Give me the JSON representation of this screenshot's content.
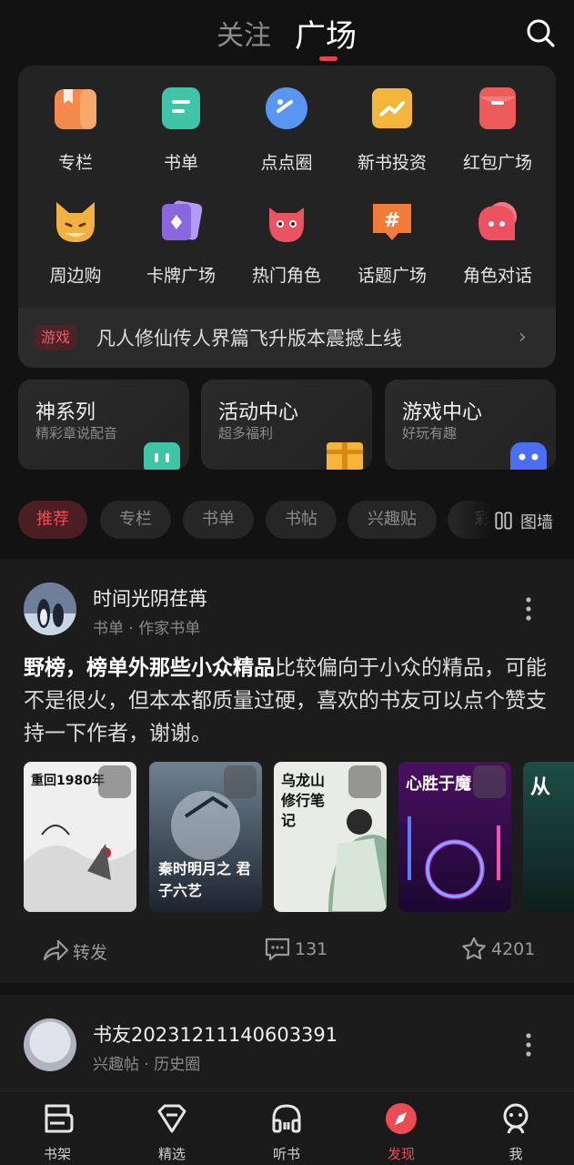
{
  "header": {
    "tabs": [
      {
        "label": "关注",
        "active": false
      },
      {
        "label": "广场",
        "active": true
      }
    ],
    "search_icon": "search-icon"
  },
  "grid": {
    "items": [
      {
        "label": "专栏",
        "icon": "column-icon",
        "color": "#f38a4b"
      },
      {
        "label": "书单",
        "icon": "booklist-icon",
        "color": "#3fc4a8"
      },
      {
        "label": "点点圈",
        "icon": "planet-icon",
        "color": "#4a8cf0"
      },
      {
        "label": "新书投资",
        "icon": "invest-icon",
        "color": "#f5b53a"
      },
      {
        "label": "红包广场",
        "icon": "redpacket-icon",
        "color": "#ec5a5a"
      },
      {
        "label": "周边购",
        "icon": "fox-icon",
        "color": "#f3b144"
      },
      {
        "label": "卡牌广场",
        "icon": "cards-icon",
        "color": "#8a66e0"
      },
      {
        "label": "热门角色",
        "icon": "monster-icon",
        "color": "#ea5461"
      },
      {
        "label": "话题广场",
        "icon": "hashtag-icon",
        "color": "#f27b3a"
      },
      {
        "label": "角色对话",
        "icon": "chat-bubble-icon",
        "color": "#ee5260"
      }
    ],
    "promo": {
      "tag": "游戏",
      "text": "凡人修仙传人界篇飞升版本震撼上线"
    }
  },
  "cards": [
    {
      "title": "神系列",
      "subtitle": "精彩章说配音"
    },
    {
      "title": "活动中心",
      "subtitle": "超多福利"
    },
    {
      "title": "游戏中心",
      "subtitle": "好玩有趣"
    }
  ],
  "filters": {
    "chips": [
      "推荐",
      "专栏",
      "书单",
      "书帖",
      "兴趣贴",
      "彩"
    ],
    "active": "推荐",
    "wall_label": "图墙"
  },
  "post": {
    "username": "时间光阴荏苒",
    "meta": "书单 · 作家书单",
    "title_bold": "野榜，榜单外那些小众精品",
    "body": "比较偏向于小众的精品，可能不是很火，但本本都质量过硬，喜欢的书友可以点个赞支持一下作者，谢谢。",
    "books": [
      {
        "title": "重回1980年",
        "color": "#efefef"
      },
      {
        "title": "秦时明月之 君子六艺",
        "color": "#3a4a5e"
      },
      {
        "title": "乌龙山修行笔记",
        "color": "#e9ece4"
      },
      {
        "title": "心胜于魔",
        "color": "#3a1450"
      },
      {
        "title": "从",
        "color": "#1d4e44"
      }
    ],
    "share_label": "转发",
    "comments": "131",
    "likes": "4201"
  },
  "post2": {
    "username": "书友20231211140603391",
    "meta": "兴趣帖 · 历史圈"
  },
  "bottom_nav": [
    {
      "label": "书架",
      "icon": "bookshelf-icon",
      "active": false
    },
    {
      "label": "精选",
      "icon": "diamond-icon",
      "active": false
    },
    {
      "label": "听书",
      "icon": "headphones-icon",
      "active": false
    },
    {
      "label": "发现",
      "icon": "compass-icon",
      "active": true
    },
    {
      "label": "我",
      "icon": "profile-icon",
      "active": false
    }
  ],
  "accent_color": "#ec4b54"
}
